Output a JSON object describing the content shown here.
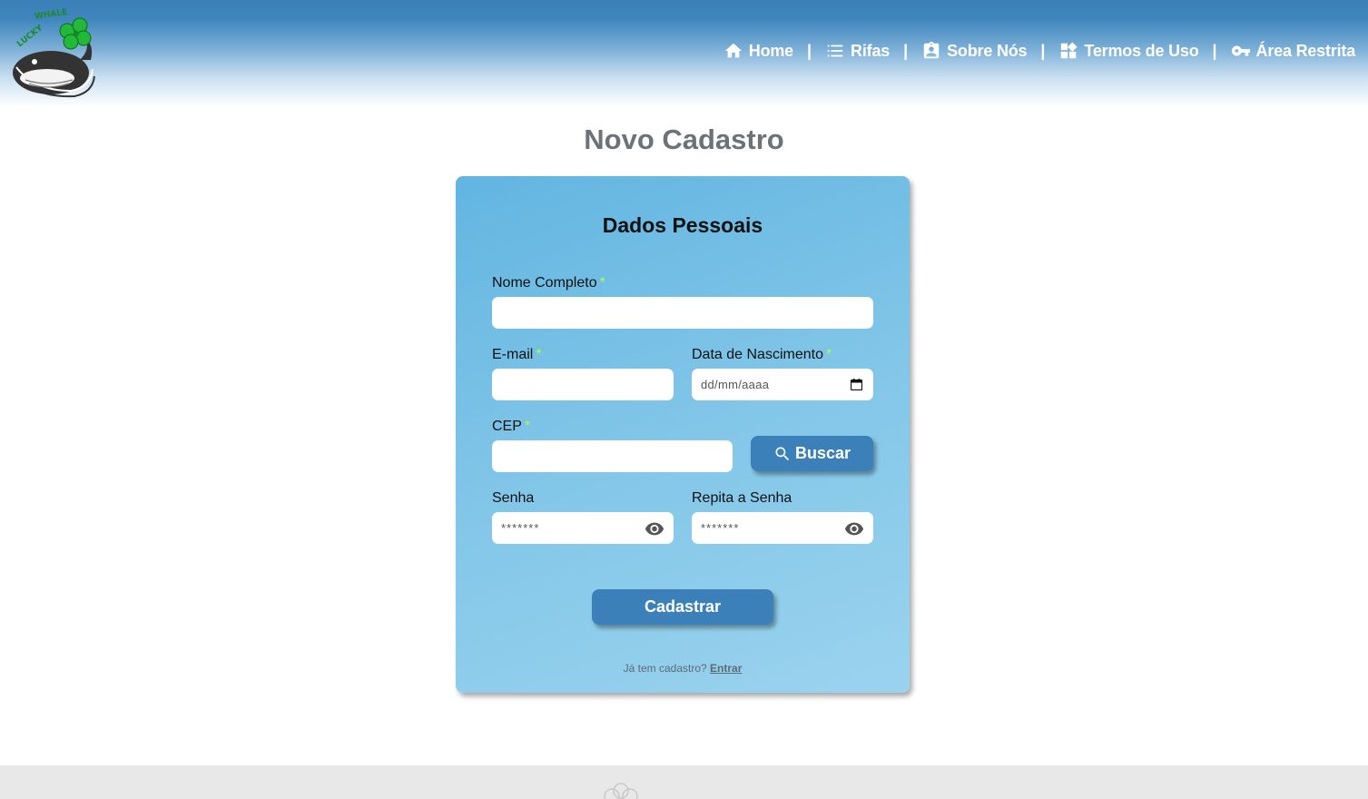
{
  "header": {
    "logo_text": "LUCKY WHALE",
    "nav": [
      {
        "label": "Home",
        "icon": "home-icon"
      },
      {
        "label": "Rifas",
        "icon": "list-icon"
      },
      {
        "label": "Sobre Nós",
        "icon": "contact-card-icon"
      },
      {
        "label": "Termos de Uso",
        "icon": "widgets-icon"
      },
      {
        "label": "Área Restrita",
        "icon": "key-icon"
      }
    ],
    "separator": "|"
  },
  "page": {
    "title": "Novo Cadastro"
  },
  "form": {
    "title": "Dados Pessoais",
    "required_mark": "*",
    "fields": {
      "nome": {
        "label": "Nome Completo",
        "value": "",
        "required": true
      },
      "email": {
        "label": "E-mail",
        "value": "",
        "required": true
      },
      "nascimento": {
        "label": "Data de Nascimento",
        "placeholder": "dd/mm/aaaa",
        "required": true
      },
      "cep": {
        "label": "CEP",
        "value": "",
        "required": true
      },
      "senha": {
        "label": "Senha",
        "value": "*******"
      },
      "repita_senha": {
        "label": "Repita a Senha",
        "value": "*******"
      }
    },
    "buscar_label": "Buscar",
    "submit_label": "Cadastrar",
    "login_prompt": "Já tem cadastro?",
    "login_link": "Entrar"
  },
  "colors": {
    "header_blue": "#3b80b8",
    "button_blue": "#3b80b8",
    "required_green": "#a7ff4a",
    "title_gray": "#6c7378"
  }
}
